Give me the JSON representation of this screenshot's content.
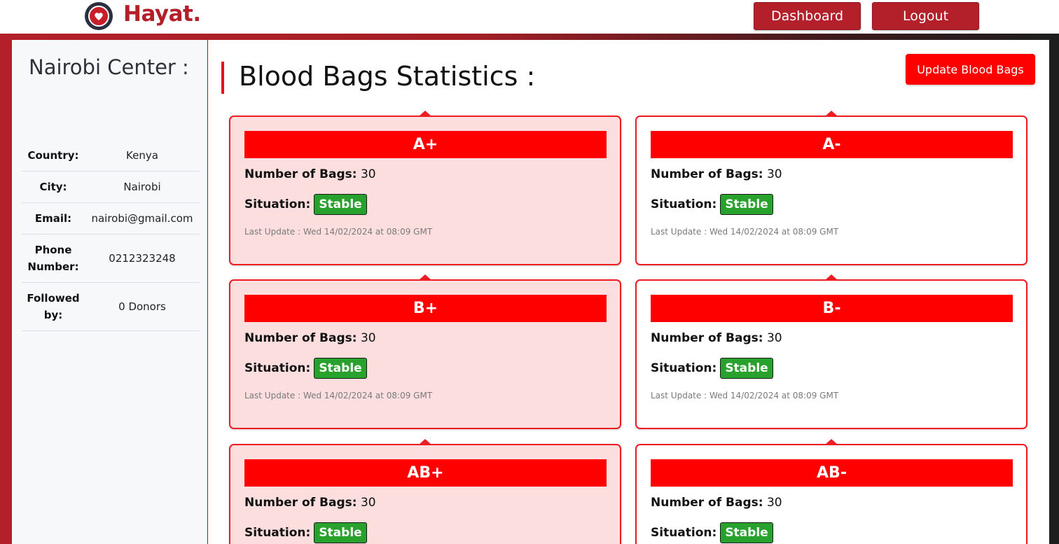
{
  "brand": {
    "name": "Hayat.",
    "logo_icon": "blood-drop-heart-icon"
  },
  "nav": {
    "dashboard_label": "Dashboard",
    "logout_label": "Logout"
  },
  "sidebar": {
    "center_name": "Nairobi Center :",
    "info": [
      {
        "label": "Country:",
        "value": "Kenya"
      },
      {
        "label": "City:",
        "value": "Nairobi"
      },
      {
        "label": "Email:",
        "value": "nairobi@gmail.com"
      },
      {
        "label": "Phone Number:",
        "value": "0212323248"
      },
      {
        "label": "Followed by:",
        "value": "0 Donors"
      }
    ]
  },
  "main": {
    "title": "Blood Bags Statistics :",
    "update_button_label": "Update Blood Bags",
    "bags_label": "Number of Bags:",
    "situation_label": "Situation:",
    "cards": [
      {
        "group": "A+",
        "bags": "30",
        "situation": "Stable",
        "last_update": "Last Update : Wed 14/02/2024 at 08:09 GMT"
      },
      {
        "group": "A-",
        "bags": "30",
        "situation": "Stable",
        "last_update": "Last Update : Wed 14/02/2024 at 08:09 GMT"
      },
      {
        "group": "B+",
        "bags": "30",
        "situation": "Stable",
        "last_update": "Last Update : Wed 14/02/2024 at 08:09 GMT"
      },
      {
        "group": "B-",
        "bags": "30",
        "situation": "Stable",
        "last_update": "Last Update : Wed 14/02/2024 at 08:09 GMT"
      },
      {
        "group": "AB+",
        "bags": "30",
        "situation": "Stable",
        "last_update": ""
      },
      {
        "group": "AB-",
        "bags": "30",
        "situation": "Stable",
        "last_update": ""
      }
    ]
  },
  "colors": {
    "brand": "#b3202a",
    "accent": "#ff0000",
    "stable": "#28a12d",
    "card_pink": "#fddede"
  }
}
